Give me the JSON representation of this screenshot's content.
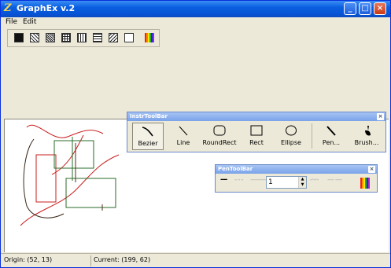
{
  "window": {
    "title": "GraphEx v.2"
  },
  "menu": [
    "File",
    "Edit"
  ],
  "fill_patterns": [
    "solid",
    "diagonal-dots",
    "dense-dots",
    "grid",
    "vertical-lines",
    "horizontal-lines",
    "diagonal-lines",
    "empty",
    "color-palette"
  ],
  "instr_toolbar": {
    "title": "InstrToolBar",
    "tools": [
      {
        "name": "bezier",
        "label": "Bezier",
        "selected": true
      },
      {
        "name": "line",
        "label": "Line"
      },
      {
        "name": "roundrect",
        "label": "RoundRect"
      },
      {
        "name": "rect",
        "label": "Rect"
      },
      {
        "name": "ellipse",
        "label": "Ellipse"
      },
      {
        "name": "pen",
        "label": "Pen..."
      },
      {
        "name": "brush",
        "label": "Brush..."
      }
    ]
  },
  "pen_toolbar": {
    "title": "PenToolBar",
    "width_value": "1",
    "styles": [
      "solid",
      "dash",
      "dot",
      "dash-dot",
      "dash-dot-dot"
    ]
  },
  "status": {
    "origin": "Origin: (52, 13)",
    "current": "Current: (199, 62)"
  },
  "colors": {
    "accent": "#0853d6",
    "red_curve": "#c81e1e",
    "green_shape": "#2a6b2a",
    "dark_curve": "#5a2a1a"
  }
}
